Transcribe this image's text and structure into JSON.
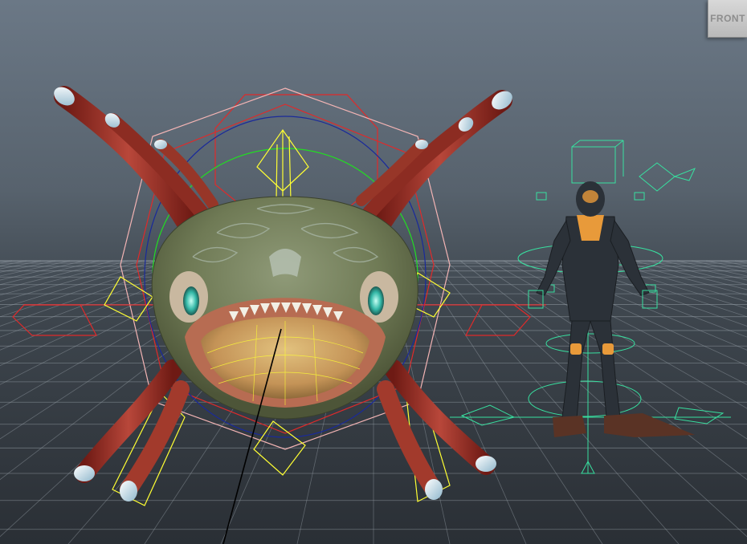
{
  "viewport": {
    "view_cube_label": "FRONT",
    "colors": {
      "sky_top": "#6b7886",
      "sky_bottom": "#2a2f35",
      "grid": "#9aa3ab",
      "creature_body": "#7d8a5a",
      "creature_belly": "#c9a06a",
      "tentacle_red": "#9b2b22",
      "tentacle_tip": "#cfe3ec",
      "rig_red": "#e02a2a",
      "rig_pink": "#f3b4b4",
      "rig_yellow": "#ffff33",
      "rig_green": "#22dd22",
      "rig_blue": "#1a2a9a",
      "rig_cyan": "#38e0a0",
      "diver_suit": "#2b3138",
      "diver_accent": "#e89a3a"
    },
    "icons": [
      "view-cube",
      "creature-model",
      "creature-rig",
      "diver-model",
      "diver-rig",
      "ground-grid"
    ]
  }
}
